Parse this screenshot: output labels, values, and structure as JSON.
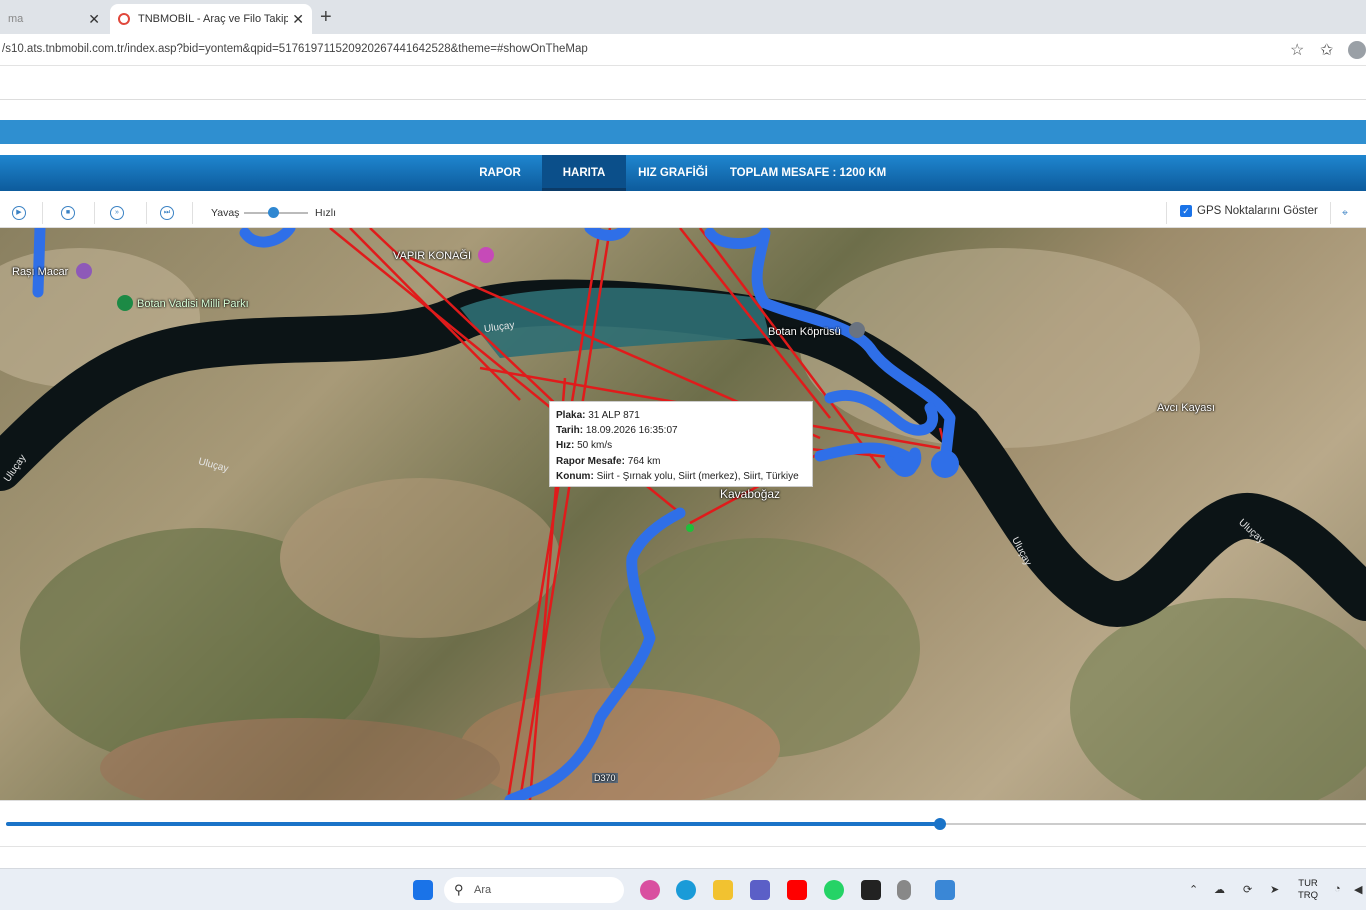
{
  "browser": {
    "tab_inactive": "ma",
    "tab_active": "TNBMOBİL - Araç ve Filo Takip Sist",
    "url": "/s10.ats.tnbmobil.com.tr/index.asp?bid=yontem&qpid=517619711520920267441642528&theme=#showOnTheMap"
  },
  "nav": {
    "tabs": [
      "RAPOR",
      "HARITA",
      "HIZ GRAFİĞİ",
      "TOPLAM MESAFE : 1200 KM"
    ],
    "active": "HARITA"
  },
  "controls": {
    "slow_label": "Yavaş",
    "fast_label": "Hızlı",
    "gps_label": "GPS Noktalarını Göster",
    "speed_level": 0.4
  },
  "map": {
    "labels": {
      "vapir": "VAPIR KONAĞI",
      "rasi": "Rașı Macar",
      "botan_park": "Botan Vadisi Milli Parkı",
      "botan_kopru": "Botan Köprüsü",
      "kavabogaz": "Kavaboğaz",
      "avci": "Avcı Kayası",
      "road": "D370"
    },
    "river_labels": [
      "Uluçay",
      "Uluçay",
      "Uluçay",
      "Uluçay",
      "Uluçay"
    ]
  },
  "popup": {
    "plaka_label": "Plaka:",
    "plaka": "31 ALP 871",
    "tarih_label": "Tarih:",
    "tarih": "18.09.2026 16:35:07",
    "hiz_label": "Hız:",
    "hiz": "50 km/s",
    "mesafe_label": "Rapor Mesafe:",
    "mesafe": "764 km",
    "konum_label": "Konum:",
    "konum": "Siirt - Şırnak yolu, Siirt (merkez), Siirt, Türkiye"
  },
  "timeline": {
    "progress": 0.69
  },
  "taskbar": {
    "search_placeholder": "Ara",
    "lang_top": "TUR",
    "lang_bottom": "TRQ"
  },
  "colors": {
    "route": "#2f6fe8",
    "track_line": "#e01b1b",
    "header": "#1f86cf"
  }
}
